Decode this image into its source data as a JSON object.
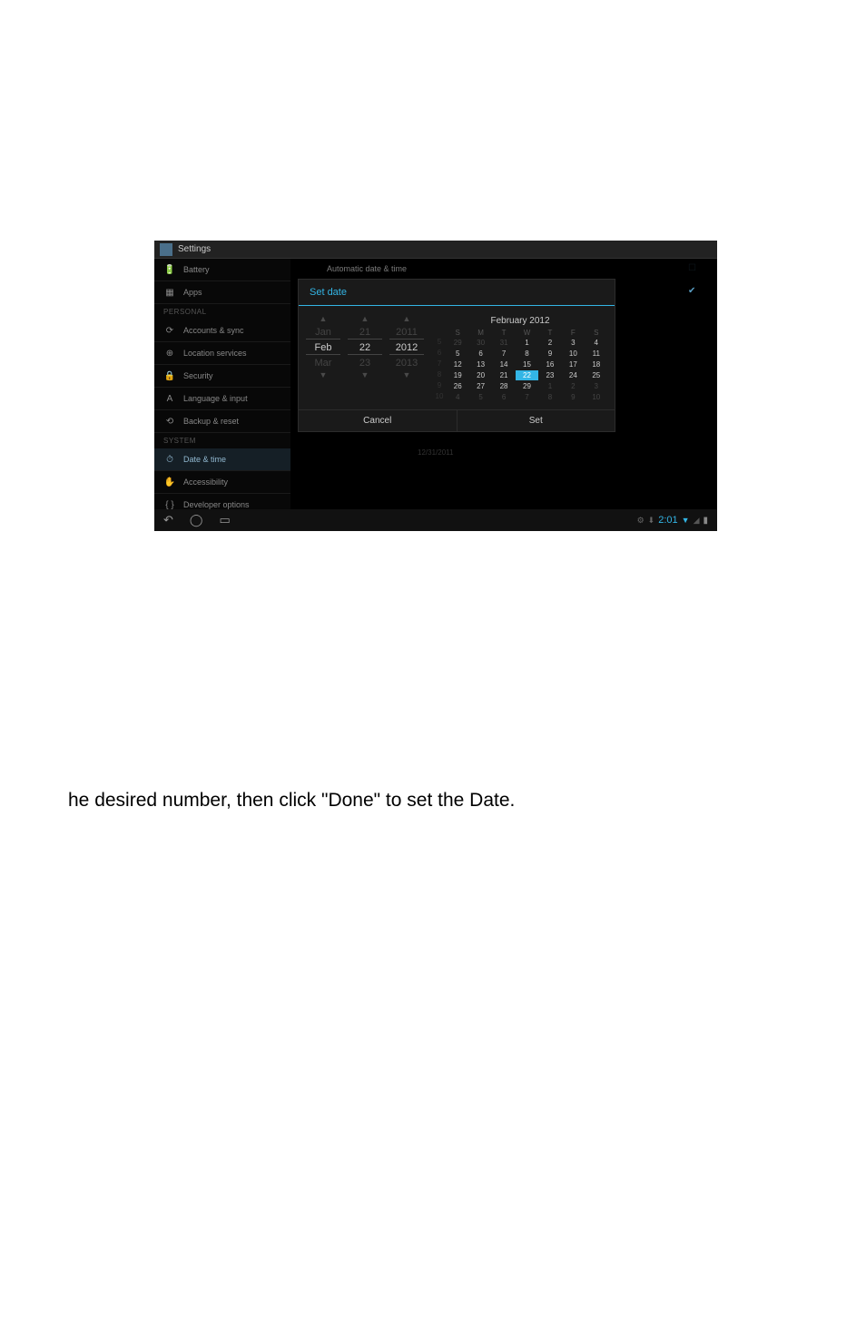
{
  "title": "Settings",
  "sidebar": {
    "items": [
      {
        "icon": "🔋",
        "label": "Battery"
      },
      {
        "icon": "▦",
        "label": "Apps"
      }
    ],
    "personal_header": "PERSONAL",
    "personal_items": [
      {
        "icon": "⟳",
        "label": "Accounts & sync"
      },
      {
        "icon": "⊕",
        "label": "Location services"
      },
      {
        "icon": "🔒",
        "label": "Security"
      },
      {
        "icon": "A",
        "label": "Language & input"
      },
      {
        "icon": "⟲",
        "label": "Backup & reset"
      }
    ],
    "system_header": "SYSTEM",
    "system_items": [
      {
        "icon": "⏱",
        "label": "Date & time"
      },
      {
        "icon": "✋",
        "label": "Accessibility"
      },
      {
        "icon": "{ }",
        "label": "Developer options"
      }
    ]
  },
  "main": {
    "auto_label": "Automatic date & time",
    "underlay_date": "12/31/2011"
  },
  "dialog": {
    "title": "Set date",
    "spinners": {
      "month": {
        "prev": "Jan",
        "current": "Feb",
        "next": "Mar"
      },
      "day": {
        "prev": "21",
        "current": "22",
        "next": "23"
      },
      "year": {
        "prev": "2011",
        "current": "2012",
        "next": "2013"
      }
    },
    "cal": {
      "header": "February 2012",
      "dow": [
        "S",
        "M",
        "T",
        "W",
        "T",
        "F",
        "S"
      ],
      "weeks": [
        {
          "wk": "5",
          "days": [
            {
              "n": "29",
              "o": true
            },
            {
              "n": "30",
              "o": true
            },
            {
              "n": "31",
              "o": true
            },
            {
              "n": "1"
            },
            {
              "n": "2"
            },
            {
              "n": "3"
            },
            {
              "n": "4"
            }
          ]
        },
        {
          "wk": "6",
          "days": [
            {
              "n": "5"
            },
            {
              "n": "6"
            },
            {
              "n": "7"
            },
            {
              "n": "8"
            },
            {
              "n": "9"
            },
            {
              "n": "10"
            },
            {
              "n": "11"
            }
          ]
        },
        {
          "wk": "7",
          "days": [
            {
              "n": "12"
            },
            {
              "n": "13"
            },
            {
              "n": "14"
            },
            {
              "n": "15"
            },
            {
              "n": "16"
            },
            {
              "n": "17"
            },
            {
              "n": "18"
            }
          ]
        },
        {
          "wk": "8",
          "days": [
            {
              "n": "19"
            },
            {
              "n": "20"
            },
            {
              "n": "21"
            },
            {
              "n": "22",
              "sel": true
            },
            {
              "n": "23"
            },
            {
              "n": "24"
            },
            {
              "n": "25"
            }
          ]
        },
        {
          "wk": "9",
          "days": [
            {
              "n": "26"
            },
            {
              "n": "27"
            },
            {
              "n": "28"
            },
            {
              "n": "29"
            },
            {
              "n": "1",
              "o": true
            },
            {
              "n": "2",
              "o": true
            },
            {
              "n": "3",
              "o": true
            }
          ]
        },
        {
          "wk": "10",
          "days": [
            {
              "n": "4",
              "o": true
            },
            {
              "n": "5",
              "o": true
            },
            {
              "n": "6",
              "o": true
            },
            {
              "n": "7",
              "o": true
            },
            {
              "n": "8",
              "o": true
            },
            {
              "n": "9",
              "o": true
            },
            {
              "n": "10",
              "o": true
            }
          ]
        }
      ]
    },
    "cancel_label": "Cancel",
    "set_label": "Set"
  },
  "statusbar": {
    "time": "2:01"
  },
  "doc_text": "he desired number, then click \"Done\" to set the Date."
}
